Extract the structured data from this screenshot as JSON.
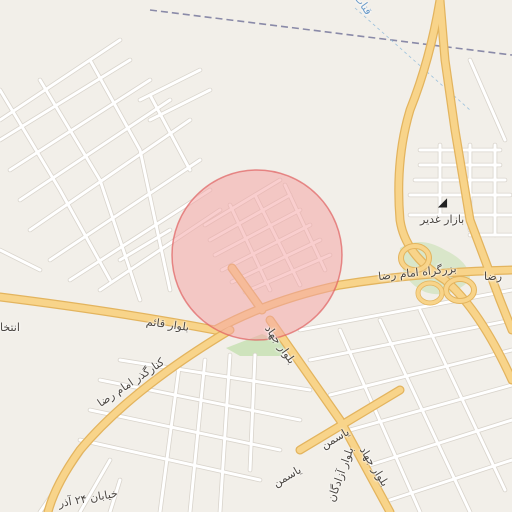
{
  "map": {
    "colors": {
      "land": "#f2efe9",
      "minor_road": "#ffffff",
      "major_road": "#f8d48a",
      "major_road_casing": "#e3b45e",
      "railway": "#8a8aa8",
      "park": "#c8e0b4",
      "radius_fill": "#f4a6a6",
      "radius_stroke": "#e06060"
    },
    "labels": {
      "canal": "قنات",
      "bazaar": "بازار غدیر",
      "imam_reza_highway_east": "بزرگراه امام رضا",
      "imam_reza_highway_fragment": "رضا",
      "qaem_blvd": "بلوار قائم",
      "imam_reza_beltway": "کنارگذر امام رضا",
      "jahad_blvd_north": "بلوار جهاد",
      "jahad_blvd_south": "بلوار جهاد",
      "yasaman_1": "یاسمن",
      "yasaman_2": "یاسمن",
      "azadegan": "بلوار آزادگان",
      "entekhab": "انتخا",
      "khayaban_24_azar": "خیابان ۲۴ آذر"
    },
    "icons": {
      "bazaar": "shopping-basket-icon"
    }
  }
}
